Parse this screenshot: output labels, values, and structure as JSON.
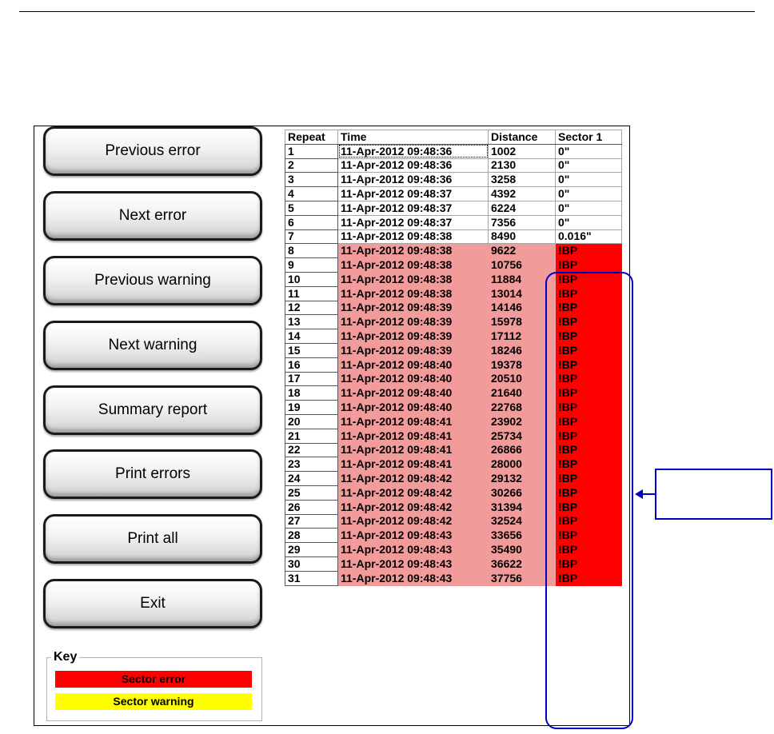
{
  "buttons": {
    "previous_error": "Previous error",
    "next_error": "Next error",
    "previous_warning": "Previous warning",
    "next_warning": "Next warning",
    "summary_report": "Summary report",
    "print_errors": "Print errors",
    "print_all": "Print all",
    "exit": "Exit"
  },
  "key": {
    "title": "Key",
    "sector_error": "Sector error",
    "sector_warning": "Sector warning"
  },
  "colors": {
    "error": "#ff0000",
    "error_row": "#f29b9b",
    "warning": "#ffff00",
    "annotation": "#0000c8"
  },
  "table": {
    "columns": [
      "Repeat",
      "Time",
      "Distance",
      "Sector 1"
    ],
    "rows": [
      {
        "repeat": "1",
        "time": "11-Apr-2012 09:48:36",
        "distance": "1002",
        "sector": "0\"",
        "status": "ok",
        "selected": true
      },
      {
        "repeat": "2",
        "time": "11-Apr-2012 09:48:36",
        "distance": "2130",
        "sector": "0\"",
        "status": "ok"
      },
      {
        "repeat": "3",
        "time": "11-Apr-2012 09:48:36",
        "distance": "3258",
        "sector": "0\"",
        "status": "ok"
      },
      {
        "repeat": "4",
        "time": "11-Apr-2012 09:48:37",
        "distance": "4392",
        "sector": "0\"",
        "status": "ok"
      },
      {
        "repeat": "5",
        "time": "11-Apr-2012 09:48:37",
        "distance": "6224",
        "sector": "0\"",
        "status": "ok"
      },
      {
        "repeat": "6",
        "time": "11-Apr-2012 09:48:37",
        "distance": "7356",
        "sector": "0\"",
        "status": "ok"
      },
      {
        "repeat": "7",
        "time": "11-Apr-2012 09:48:38",
        "distance": "8490",
        "sector": "0.016\"",
        "status": "ok"
      },
      {
        "repeat": "8",
        "time": "11-Apr-2012 09:48:38",
        "distance": "9622",
        "sector": "!BP",
        "status": "error"
      },
      {
        "repeat": "9",
        "time": "11-Apr-2012 09:48:38",
        "distance": "10756",
        "sector": "!BP",
        "status": "error"
      },
      {
        "repeat": "10",
        "time": "11-Apr-2012 09:48:38",
        "distance": "11884",
        "sector": "!BP",
        "status": "error"
      },
      {
        "repeat": "11",
        "time": "11-Apr-2012 09:48:38",
        "distance": "13014",
        "sector": "!BP",
        "status": "error"
      },
      {
        "repeat": "12",
        "time": "11-Apr-2012 09:48:39",
        "distance": "14146",
        "sector": "!BP",
        "status": "error"
      },
      {
        "repeat": "13",
        "time": "11-Apr-2012 09:48:39",
        "distance": "15978",
        "sector": "!BP",
        "status": "error"
      },
      {
        "repeat": "14",
        "time": "11-Apr-2012 09:48:39",
        "distance": "17112",
        "sector": "!BP",
        "status": "error"
      },
      {
        "repeat": "15",
        "time": "11-Apr-2012 09:48:39",
        "distance": "18246",
        "sector": "!BP",
        "status": "error"
      },
      {
        "repeat": "16",
        "time": "11-Apr-2012 09:48:40",
        "distance": "19378",
        "sector": "!BP",
        "status": "error"
      },
      {
        "repeat": "17",
        "time": "11-Apr-2012 09:48:40",
        "distance": "20510",
        "sector": "!BP",
        "status": "error"
      },
      {
        "repeat": "18",
        "time": "11-Apr-2012 09:48:40",
        "distance": "21640",
        "sector": "!BP",
        "status": "error"
      },
      {
        "repeat": "19",
        "time": "11-Apr-2012 09:48:40",
        "distance": "22768",
        "sector": "!BP",
        "status": "error"
      },
      {
        "repeat": "20",
        "time": "11-Apr-2012 09:48:41",
        "distance": "23902",
        "sector": "!BP",
        "status": "error"
      },
      {
        "repeat": "21",
        "time": "11-Apr-2012 09:48:41",
        "distance": "25734",
        "sector": "!BP",
        "status": "error"
      },
      {
        "repeat": "22",
        "time": "11-Apr-2012 09:48:41",
        "distance": "26866",
        "sector": "!BP",
        "status": "error"
      },
      {
        "repeat": "23",
        "time": "11-Apr-2012 09:48:41",
        "distance": "28000",
        "sector": "!BP",
        "status": "error"
      },
      {
        "repeat": "24",
        "time": "11-Apr-2012 09:48:42",
        "distance": "29132",
        "sector": "!BP",
        "status": "error"
      },
      {
        "repeat": "25",
        "time": "11-Apr-2012 09:48:42",
        "distance": "30266",
        "sector": "!BP",
        "status": "error"
      },
      {
        "repeat": "26",
        "time": "11-Apr-2012 09:48:42",
        "distance": "31394",
        "sector": "!BP",
        "status": "error"
      },
      {
        "repeat": "27",
        "time": "11-Apr-2012 09:48:42",
        "distance": "32524",
        "sector": "!BP",
        "status": "error"
      },
      {
        "repeat": "28",
        "time": "11-Apr-2012 09:48:43",
        "distance": "33656",
        "sector": "!BP",
        "status": "error"
      },
      {
        "repeat": "29",
        "time": "11-Apr-2012 09:48:43",
        "distance": "35490",
        "sector": "!BP",
        "status": "error"
      },
      {
        "repeat": "30",
        "time": "11-Apr-2012 09:48:43",
        "distance": "36622",
        "sector": "!BP",
        "status": "error"
      },
      {
        "repeat": "31",
        "time": "11-Apr-2012 09:48:43",
        "distance": "37756",
        "sector": "!BP",
        "status": "error"
      }
    ]
  }
}
